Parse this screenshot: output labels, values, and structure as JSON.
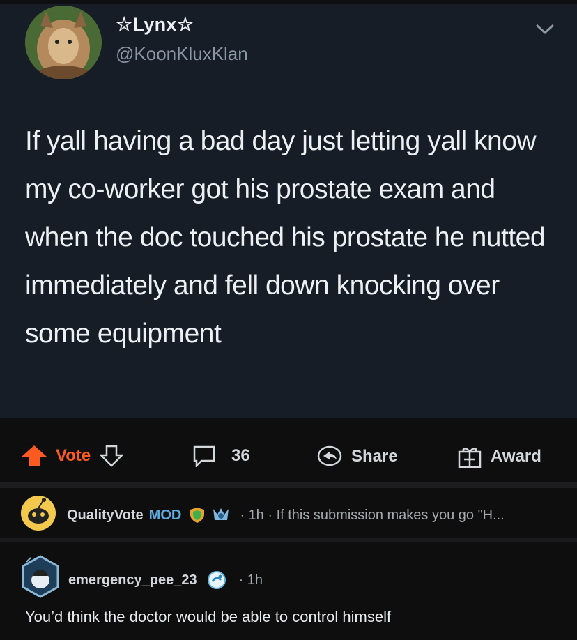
{
  "tweet": {
    "display_name": "☆Lynx☆",
    "handle": "@KoonKluxKlan",
    "text": "If yall having a bad day just letting yall know my co-worker got his prostate exam and when the doc touched his prostate he nutted immediately and fell down knocking over some equipment"
  },
  "actions": {
    "vote_label": "Vote",
    "comments_count": "36",
    "share_label": "Share",
    "award_label": "Award"
  },
  "pinned_comment": {
    "username": "QualityVote",
    "mod_label": "MOD",
    "meta": "· 1h · If this submission makes you go \"H..."
  },
  "comment": {
    "username": "emergency_pee_23",
    "meta": "· 1h",
    "body": "You’d think the doctor would be able to control himself"
  },
  "colors": {
    "upvote": "#ff5a1f",
    "mod": "#5dade2",
    "tweet_bg": "#161d27"
  }
}
